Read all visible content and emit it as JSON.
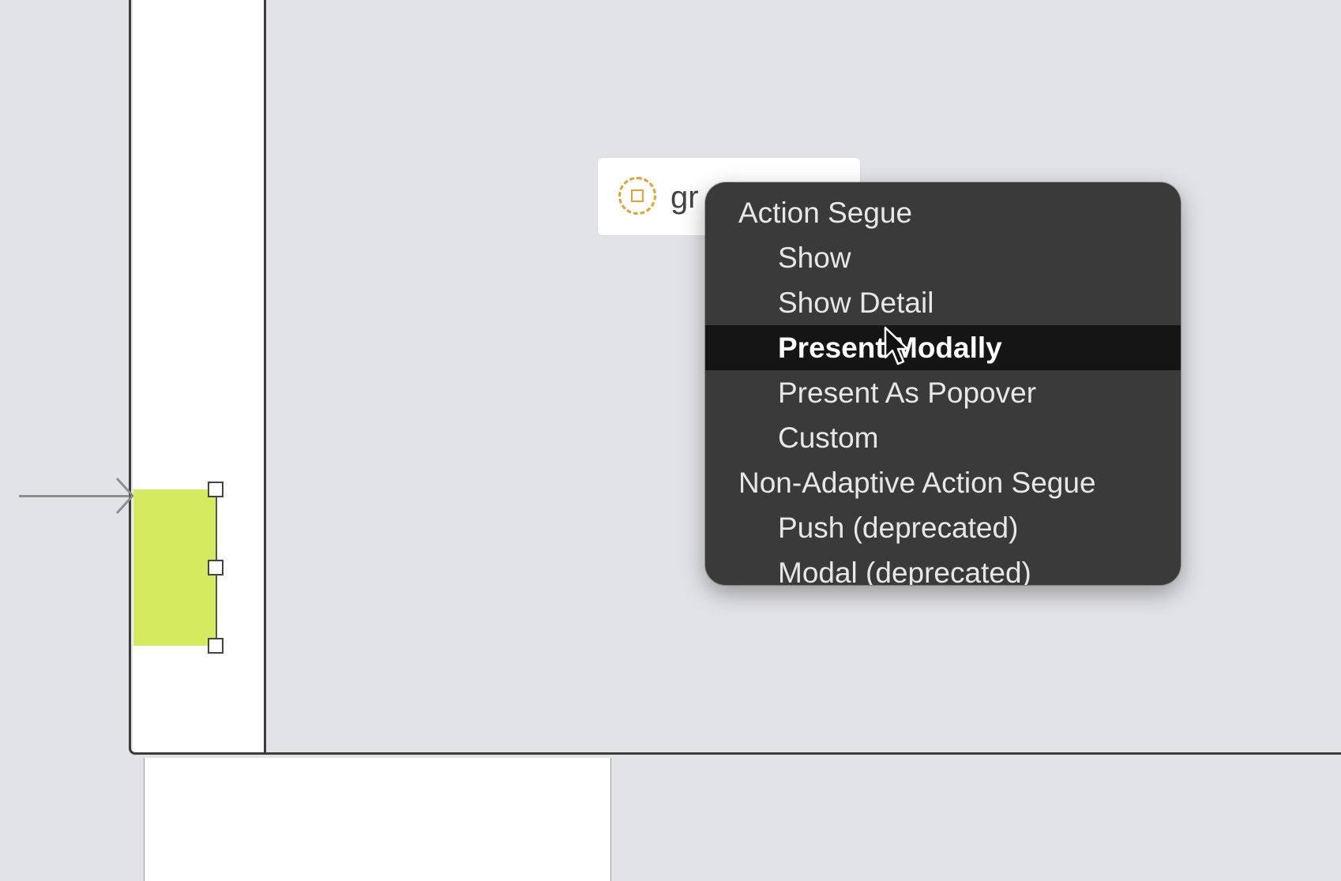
{
  "outlet_chip": {
    "label": "gr",
    "icon": "outlet-circle-icon"
  },
  "context_menu": {
    "sections": [
      {
        "header": "Action Segue",
        "items": [
          "Show",
          "Show Detail",
          "Present Modally",
          "Present As Popover",
          "Custom"
        ]
      },
      {
        "header": "Non-Adaptive Action Segue",
        "items": [
          "Push (deprecated)",
          "Modal (deprecated)"
        ]
      }
    ],
    "highlighted_item": "Present Modally"
  },
  "colors": {
    "canvas_background": "#e2e3e6",
    "menu_background": "#3a3a3a",
    "menu_highlight": "#151515",
    "selected_view": "#d5ea5e",
    "outlet_icon": "#e0a33a"
  }
}
